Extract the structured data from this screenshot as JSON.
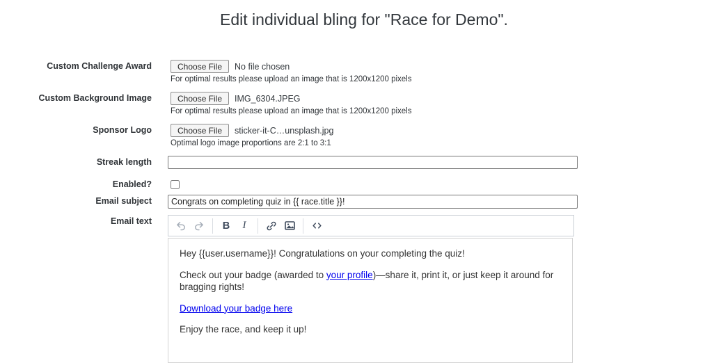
{
  "page": {
    "title": "Edit individual bling for \"Race for Demo\"."
  },
  "fields": {
    "award": {
      "label": "Custom Challenge Award",
      "button": "Choose File",
      "file": "No file chosen",
      "help": "For optimal results please upload an image that is 1200x1200 pixels"
    },
    "background": {
      "label": "Custom Background Image",
      "button": "Choose File",
      "file": "IMG_6304.JPEG",
      "help": "For optimal results please upload an image that is 1200x1200 pixels"
    },
    "sponsor": {
      "label": "Sponsor Logo",
      "button": "Choose File",
      "file": "sticker-it-C…unsplash.jpg",
      "help": "Optimal logo image proportions are 2:1 to 3:1"
    },
    "streak": {
      "label": "Streak length",
      "value": ""
    },
    "enabled": {
      "label": "Enabled?",
      "checked": false
    },
    "subject": {
      "label": "Email subject",
      "value": "Congrats on completing quiz in {{ race.title }}!"
    },
    "body": {
      "label": "Email text"
    }
  },
  "editor": {
    "toolbar": {
      "undo": "undo-icon",
      "redo": "redo-icon",
      "bold": "B",
      "italic": "I",
      "link": "link-icon",
      "image": "image-icon",
      "code": "code-icon"
    },
    "content": {
      "greeting": "Hey {{user.username}}! Congratulations on your completing the quiz!",
      "badge_before": "Check out your badge (awarded to ",
      "badge_link": "your profile",
      "badge_after": ")—share it, print it, or just keep it around for bragging rights!",
      "download_link": "Download your badge here",
      "closing": "Enjoy the race, and keep it up!"
    }
  },
  "colors": {
    "link": "#0000ee",
    "icon_active": "#3e4a5c",
    "icon_disabled": "#a8b0ba",
    "input_border": "#767676"
  }
}
